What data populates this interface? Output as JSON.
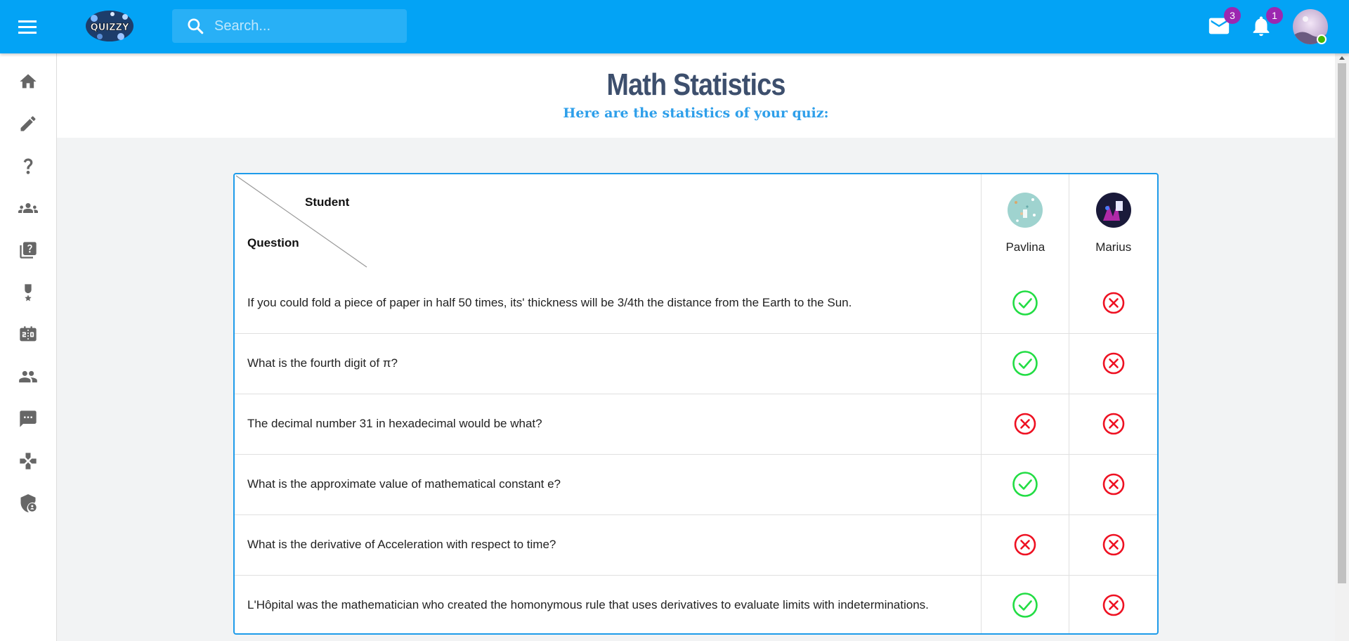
{
  "app": {
    "logo_text": "QUIZZY"
  },
  "search": {
    "placeholder": "Search..."
  },
  "header_icons": {
    "mail_count": "3",
    "notification_count": "1"
  },
  "sidebar": {
    "items": [
      {
        "name": "home-icon"
      },
      {
        "name": "pencil-icon"
      },
      {
        "name": "question-icon"
      },
      {
        "name": "groups-icon"
      },
      {
        "name": "quiz-library-icon"
      },
      {
        "name": "award-icon"
      },
      {
        "name": "scoreboard-icon"
      },
      {
        "name": "people-icon"
      },
      {
        "name": "chat-icon"
      },
      {
        "name": "games-icon"
      },
      {
        "name": "admin-shield-icon"
      }
    ]
  },
  "page": {
    "title": "Math Statistics",
    "subtitle": "Here are the statistics of your quiz:"
  },
  "table": {
    "header_student": "Student",
    "header_question": "Question",
    "students": [
      {
        "name": "Pavlina"
      },
      {
        "name": "Marius"
      }
    ],
    "rows": [
      {
        "question": "If you could fold a piece of paper in half 50 times, its' thickness will be 3/4th the distance from the Earth to the Sun.",
        "results": [
          "correct",
          "wrong"
        ]
      },
      {
        "question": "What is the fourth digit of π?",
        "results": [
          "correct",
          "wrong"
        ]
      },
      {
        "question": "The decimal number 31 in hexadecimal would be what?",
        "results": [
          "wrong",
          "wrong"
        ]
      },
      {
        "question": "What is the approximate value of mathematical constant e?",
        "results": [
          "correct",
          "wrong"
        ]
      },
      {
        "question": "What is the derivative of Acceleration with respect to time?",
        "results": [
          "wrong",
          "wrong"
        ]
      },
      {
        "question": "L'Hôpital was the mathematician who created the homonymous rule that uses derivatives to evaluate limits with indeterminations.",
        "results": [
          "correct",
          "wrong"
        ]
      }
    ]
  },
  "colors": {
    "topbar": "#03a3f5",
    "correct": "#22dd44",
    "wrong": "#ee1122",
    "title": "#3d4f6d",
    "subtitle": "#2e9fea",
    "badge": "#9c27b0"
  }
}
